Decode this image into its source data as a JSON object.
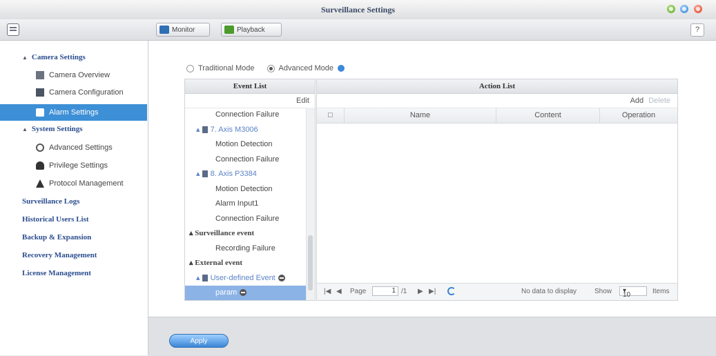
{
  "window": {
    "title": "Surveillance Settings"
  },
  "toolbar": {
    "monitor_label": "Monitor",
    "playback_label": "Playback",
    "help_label": "?"
  },
  "sidebar": {
    "camera_settings": "Camera Settings",
    "camera_overview": "Camera Overview",
    "camera_configuration": "Camera Configuration",
    "alarm_settings": "Alarm Settings",
    "system_settings": "System Settings",
    "advanced_settings": "Advanced Settings",
    "privilege_settings": "Privilege Settings",
    "protocol_management": "Protocol Management",
    "surveillance_logs": "Surveillance Logs",
    "historical_users": "Historical Users List",
    "backup_expansion": "Backup & Expansion",
    "recovery_management": "Recovery Management",
    "license_management": "License Management"
  },
  "mode": {
    "traditional": "Traditional Mode",
    "advanced": "Advanced Mode",
    "selected": "advanced"
  },
  "event_list": {
    "header": "Event List",
    "edit_label": "Edit",
    "items": [
      {
        "label": "Connection Failure",
        "kind": "event"
      },
      {
        "label": "7. Axis M3006",
        "kind": "camera"
      },
      {
        "label": "Motion Detection",
        "kind": "event"
      },
      {
        "label": "Connection Failure",
        "kind": "event"
      },
      {
        "label": "8. Axis P3384",
        "kind": "camera"
      },
      {
        "label": "Motion Detection",
        "kind": "event"
      },
      {
        "label": "Alarm Input1",
        "kind": "event"
      },
      {
        "label": "Connection Failure",
        "kind": "event"
      },
      {
        "label": "Surveillance event",
        "kind": "group"
      },
      {
        "label": "Recording Failure",
        "kind": "event"
      },
      {
        "label": "External event",
        "kind": "group"
      },
      {
        "label": "User-defined Event",
        "kind": "camera"
      },
      {
        "label": "param",
        "kind": "selected"
      }
    ]
  },
  "action_list": {
    "header": "Action List",
    "add_label": "Add",
    "delete_label": "Delete",
    "columns": [
      "Name",
      "Content",
      "Operation"
    ],
    "pager": {
      "page_label": "Page",
      "page_value": "1",
      "page_total": "/1",
      "empty_text": "No data to display",
      "show_label": "Show",
      "show_value": "10",
      "items_label": "Items"
    }
  },
  "footer": {
    "apply_label": "Apply"
  },
  "colors": {
    "accent": "#3d8fd6",
    "section_text": "#2b4d8f"
  }
}
